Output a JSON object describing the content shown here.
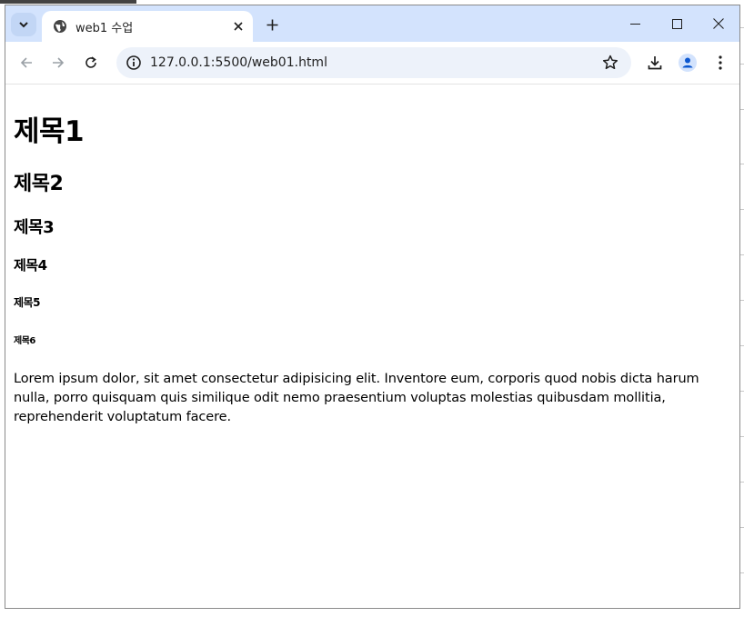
{
  "browser": {
    "tab_title": "web1 수업",
    "url": "127.0.0.1:5500/web01.html",
    "icons": [
      "tab-search-icon",
      "globe-icon",
      "close-icon",
      "plus-icon",
      "minimize-icon",
      "maximize-icon",
      "window-close-icon",
      "back-icon",
      "forward-icon",
      "reload-icon",
      "site-info-icon",
      "star-icon",
      "download-icon",
      "profile-icon",
      "menu-icon"
    ]
  },
  "page": {
    "h1": "제목1",
    "h2": "제목2",
    "h3": "제목3",
    "h4": "제목4",
    "h5": "제목5",
    "h6": "제목6",
    "paragraph": "Lorem ipsum dolor, sit amet consectetur adipisicing elit. Inventore eum, corporis quod nobis dicta harum nulla, porro quisquam quis similique odit nemo praesentium voluptas molestias quibusdam mollitia, reprehenderit voluptatum facere."
  },
  "colors": {
    "tabstrip": "#d3e3fd",
    "omnibox": "#edf2fa",
    "profile_accent": "#0b57d0"
  }
}
